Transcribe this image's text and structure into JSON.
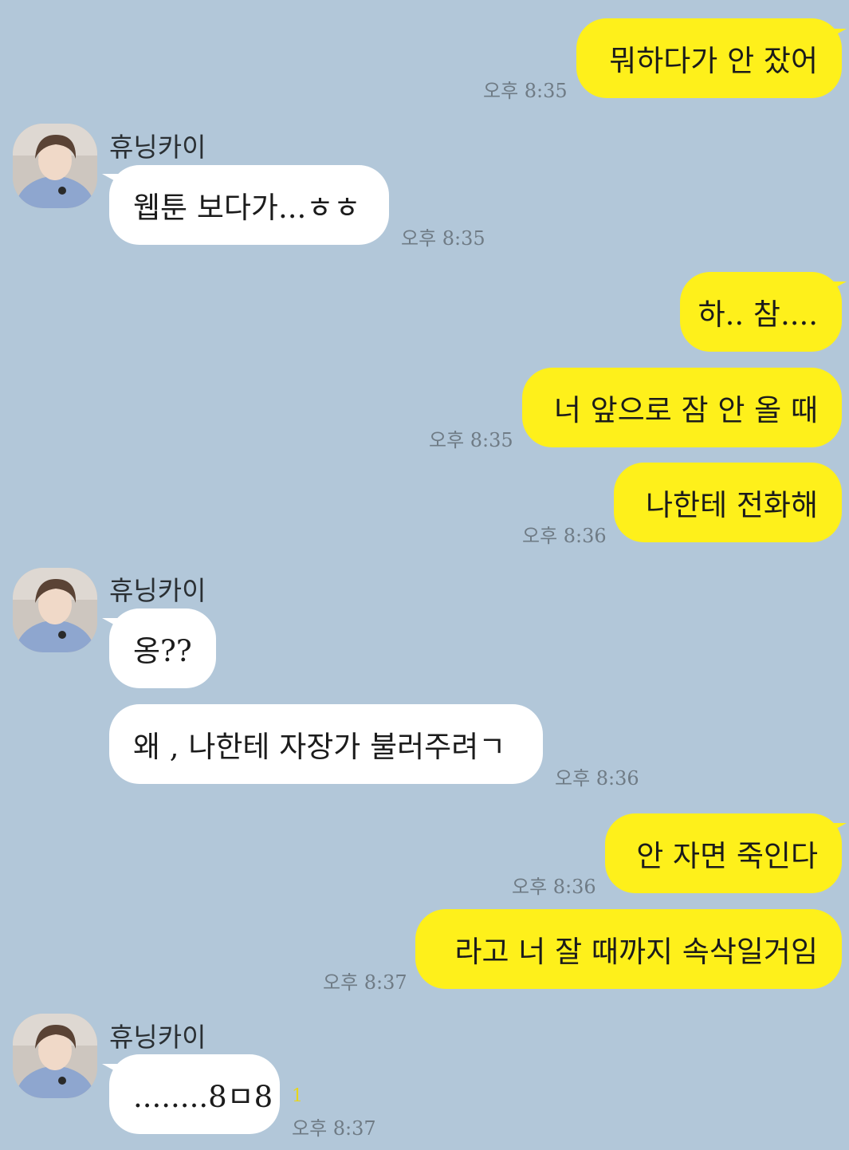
{
  "contact": {
    "name": "휴닝카이"
  },
  "colors": {
    "background": "#b2c7d9",
    "my_bubble": "#fef01b",
    "their_bubble": "#ffffff"
  },
  "messages": [
    {
      "sender": "me",
      "text": "뭐하다가 안 잤어",
      "time": "오후 8:35"
    },
    {
      "sender": "them",
      "text": "웹툰 보다가...ㅎㅎ",
      "time": "오후 8:35"
    },
    {
      "sender": "me",
      "text": "하.. 참...."
    },
    {
      "sender": "me",
      "text": "너 앞으로 잠 안 올 때",
      "time": "오후 8:35"
    },
    {
      "sender": "me",
      "text": "나한테 전화해",
      "time": "오후 8:36"
    },
    {
      "sender": "them",
      "text": "옹??"
    },
    {
      "sender": "them",
      "text": "왜 , 나한테 자장가 불러주려ㄱ",
      "time": "오후 8:36"
    },
    {
      "sender": "me",
      "text": "안 자면 죽인다",
      "time": "오후 8:36"
    },
    {
      "sender": "me",
      "text": "라고 너 잘 때까지 속삭일거임",
      "time": "오후 8:37"
    },
    {
      "sender": "them",
      "text": "........8ㅁ8",
      "time": "오후 8:37",
      "unread": "1"
    }
  ]
}
